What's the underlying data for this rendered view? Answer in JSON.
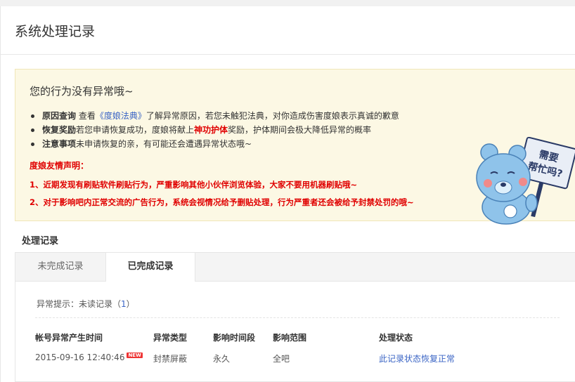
{
  "header": {
    "title": "系统处理记录"
  },
  "notice": {
    "title": "您的行为没有异常哦~",
    "items": [
      {
        "label": "原因查询",
        "pre": " 查看",
        "link": "《度娘法典》",
        "post": "了解异常原因，若您未触犯法典，对你造成伤害度娘表示真诚的歉意"
      },
      {
        "label": "恢复奖励",
        "pre": "若您申请恢复成功，度娘将献上",
        "strong": "神功护体",
        "post": "奖励，护体期间会极大降低异常的概率"
      },
      {
        "label": "注意事项",
        "post": "未申请恢复的亲，有可能还会遭遇异常状态哦~"
      }
    ],
    "declare_title": "度娘友情声明：",
    "declare_lines": [
      "1、近期发现有刷贴软件刷贴行为，严重影响其他小伙伴浏览体验，大家不要用机器刷贴哦~",
      "2、对于影响吧内正常交流的广告行为，系统会视情况给予删贴处理，行为严重者还会被给予封禁处罚的哦~"
    ],
    "mascot_sign": [
      "需要",
      "帮忙吗?"
    ],
    "colors": {
      "background": "#fcf8e4",
      "warning": "#e00000",
      "link": "#3b65c5"
    }
  },
  "records": {
    "title": "处理记录",
    "tabs": [
      {
        "label": "未完成记录"
      },
      {
        "label": "已完成记录"
      }
    ],
    "hint_label": "异常提示：未读记录（",
    "hint_count": "1",
    "hint_end": "）",
    "columns": [
      "帐号异常产生时间",
      "异常类型",
      "影响时间段",
      "影响范围",
      "处理状态"
    ],
    "rows": [
      {
        "time": "2015-09-16 12:40:46",
        "badge": "NEW",
        "type": "封禁屏蔽",
        "duration": "永久",
        "scope": "全吧",
        "status": "此记录状态恢复正常"
      }
    ]
  }
}
